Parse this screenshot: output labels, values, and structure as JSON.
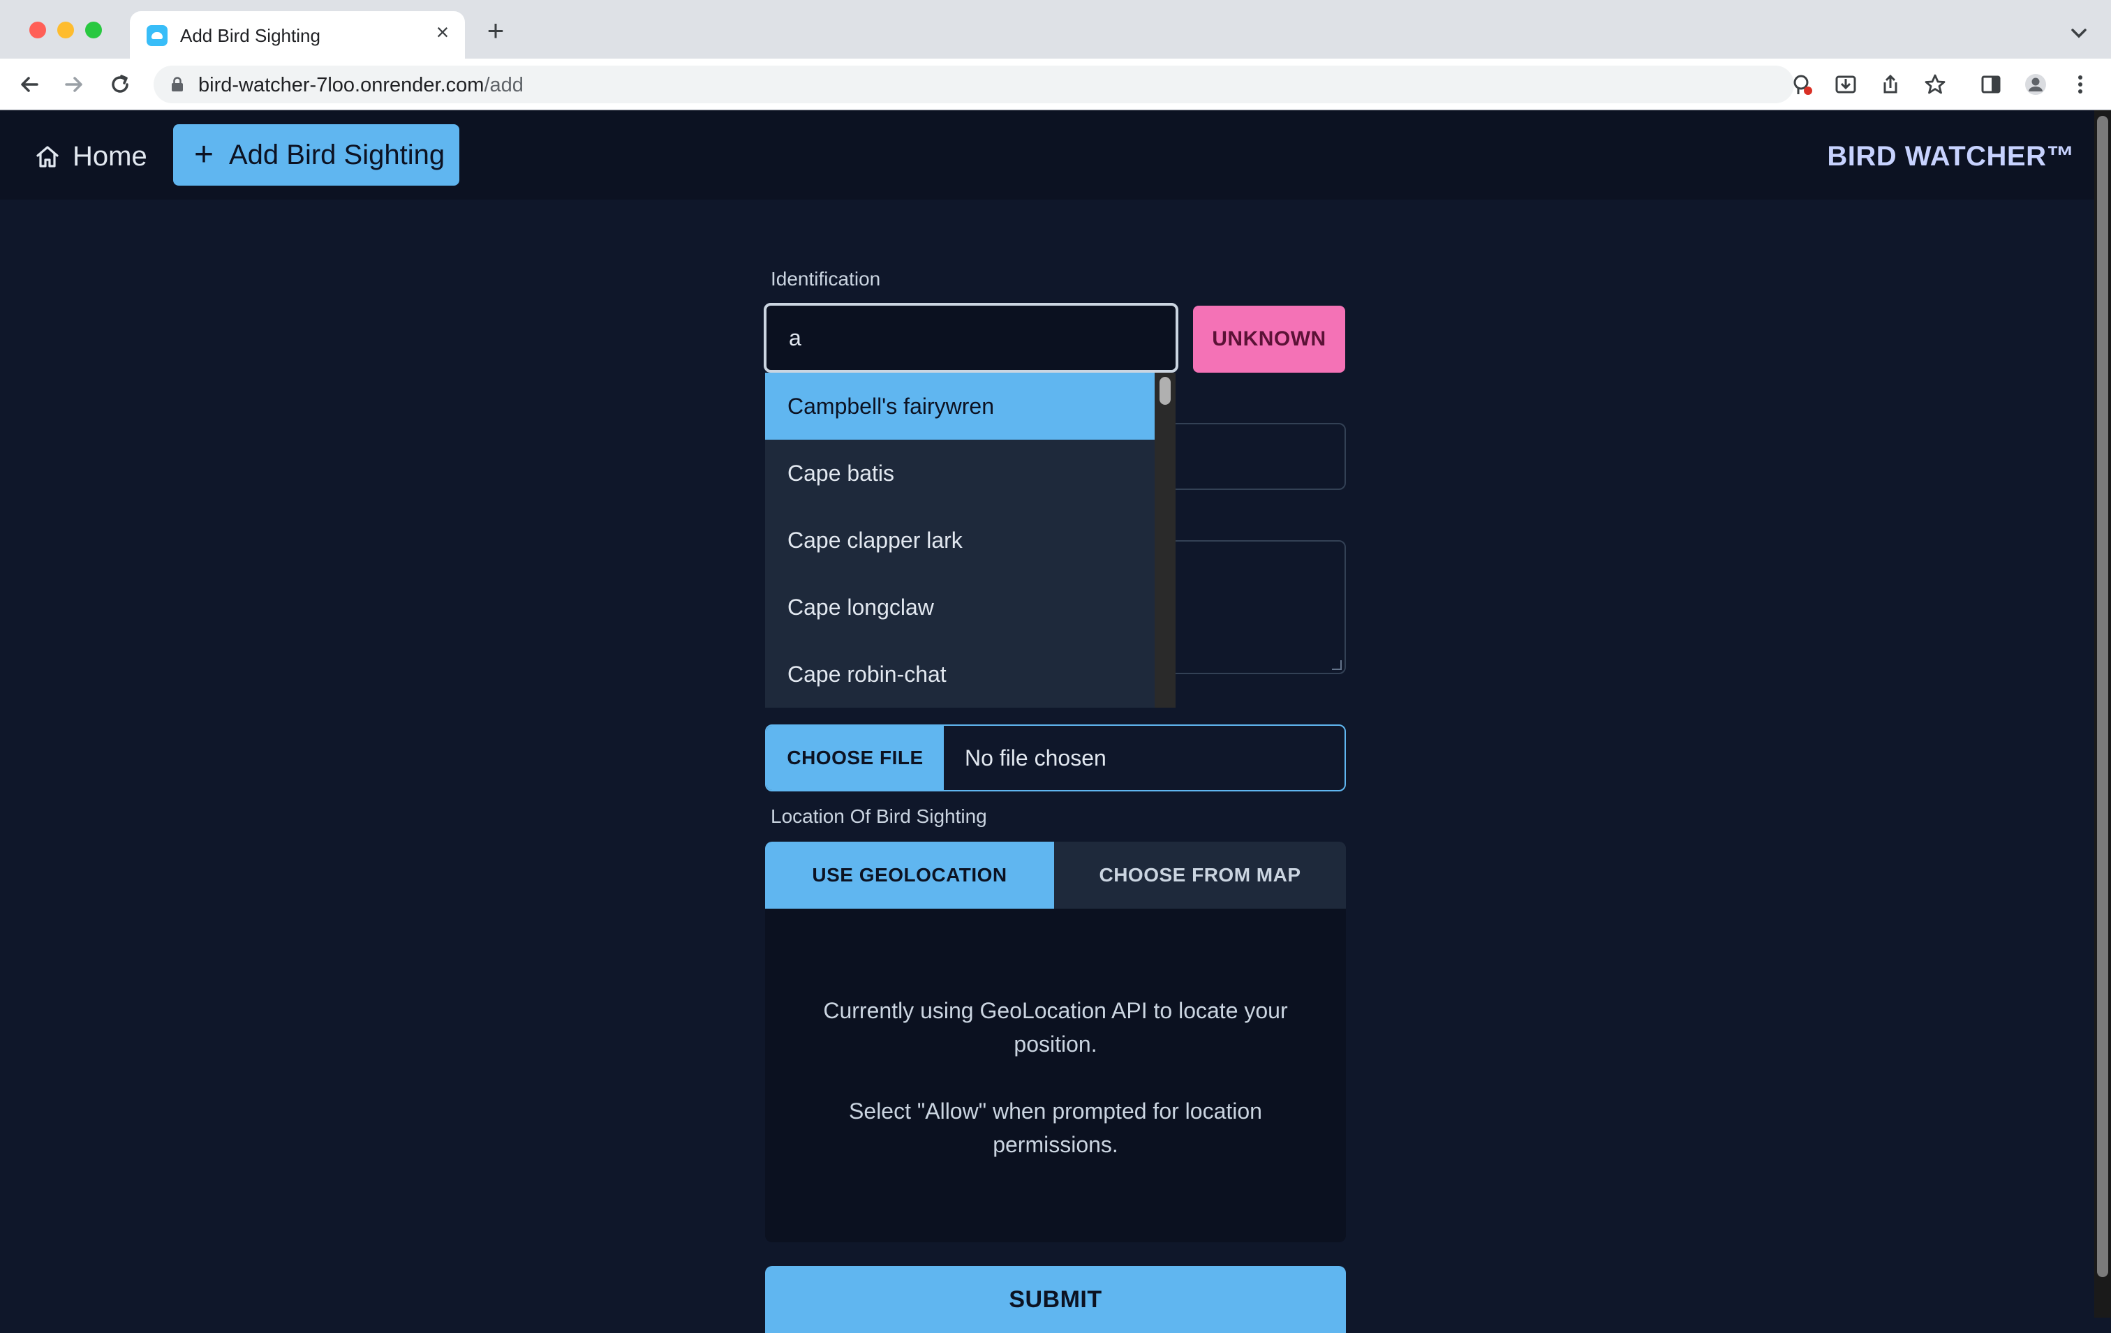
{
  "browser": {
    "tab_title": "Add Bird Sighting",
    "close_glyph": "×",
    "new_tab_glyph": "+",
    "url_host": "bird-watcher-7loo.onrender.com",
    "url_path": "/add"
  },
  "header": {
    "home_label": "Home",
    "add_glyph": "+",
    "add_label": "Add Bird Sighting",
    "brand": "BIRD WATCHER™"
  },
  "form": {
    "identification_label": "Identification",
    "identification_value": "a",
    "unknown_label": "UNKNOWN",
    "suggestions": [
      "Campbell's fairywren",
      "Cape batis",
      "Cape clapper lark",
      "Cape longclaw",
      "Cape robin-chat"
    ],
    "file_button_label": "CHOOSE FILE",
    "file_status": "No file chosen",
    "location_label": "Location Of Bird Sighting",
    "location_tabs": [
      "USE GEOLOCATION",
      "CHOOSE FROM MAP"
    ],
    "geo_message_1": "Currently using GeoLocation API to locate your position.",
    "geo_message_2": "Select \"Allow\" when prompted for location permissions.",
    "submit_label": "SUBMIT"
  },
  "colors": {
    "accent": "#60b6f0",
    "unknown": "#f472b6",
    "background": "#0f172a"
  }
}
